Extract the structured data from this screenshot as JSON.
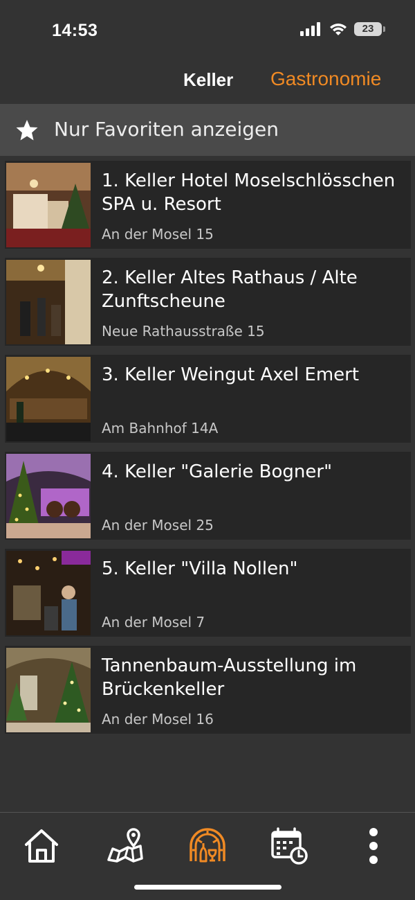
{
  "status_bar": {
    "time": "14:53",
    "battery": "23"
  },
  "tabs": [
    {
      "label": "Keller",
      "active": false
    },
    {
      "label": "Gastronomie",
      "active": true
    }
  ],
  "favorites_filter": {
    "label": "Nur Favoriten anzeigen",
    "icon": "star-icon"
  },
  "items": [
    {
      "title": "1. Keller Hotel Moselschlösschen SPA u. Resort",
      "address": "An der Mosel 15"
    },
    {
      "title": "2. Keller Altes Rathaus / Alte Zunftscheune",
      "address": "Neue Rathausstraße 15"
    },
    {
      "title": "3. Keller Weingut Axel Emert",
      "address": "Am Bahnhof 14A"
    },
    {
      "title": "4. Keller \"Galerie Bogner\"",
      "address": "An der Mosel 25"
    },
    {
      "title": "5. Keller \"Villa Nollen\"",
      "address": "An der Mosel 7"
    },
    {
      "title": "Tannenbaum-Ausstellung im Brückenkeller",
      "address": "An der Mosel 16"
    }
  ],
  "bottom_nav": [
    {
      "icon": "home-icon",
      "active": false
    },
    {
      "icon": "map-pin-icon",
      "active": false
    },
    {
      "icon": "cellar-icon",
      "active": true
    },
    {
      "icon": "calendar-clock-icon",
      "active": false
    },
    {
      "icon": "more-vertical-icon",
      "active": false
    }
  ],
  "colors": {
    "accent": "#f08a24",
    "background": "#333333",
    "card": "#262626",
    "filter_bar": "#4a4a4a"
  }
}
